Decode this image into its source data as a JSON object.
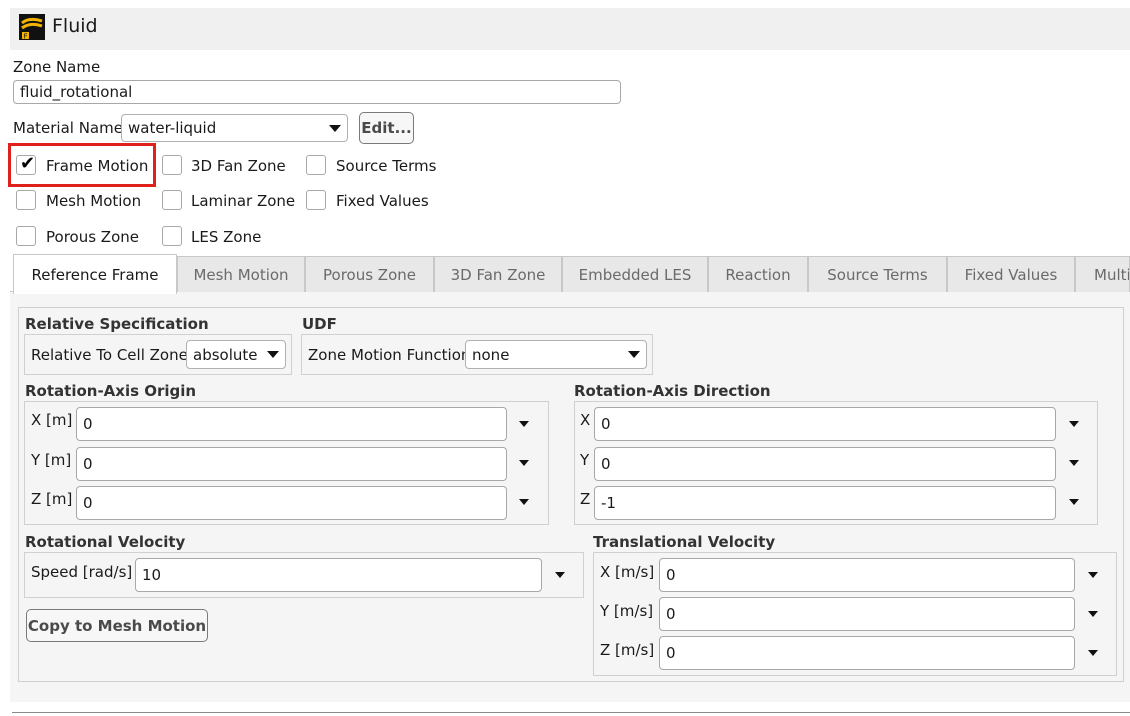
{
  "window": {
    "title": "Fluid"
  },
  "zone_name": {
    "label": "Zone Name",
    "value": "fluid_rotational"
  },
  "material": {
    "label": "Material Name",
    "value": "water-liquid",
    "edit_label": "Edit..."
  },
  "options": {
    "frame_motion": {
      "label": "Frame Motion",
      "checked": true
    },
    "fan_zone": {
      "label": "3D Fan Zone",
      "checked": false
    },
    "source_terms": {
      "label": "Source Terms",
      "checked": false
    },
    "mesh_motion": {
      "label": "Mesh Motion",
      "checked": false
    },
    "laminar_zone": {
      "label": "Laminar Zone",
      "checked": false
    },
    "fixed_values": {
      "label": "Fixed Values",
      "checked": false
    },
    "porous_zone": {
      "label": "Porous Zone",
      "checked": false
    },
    "les_zone": {
      "label": "LES Zone",
      "checked": false
    }
  },
  "tabs": [
    {
      "label": "Reference Frame",
      "active": true
    },
    {
      "label": "Mesh Motion"
    },
    {
      "label": "Porous Zone"
    },
    {
      "label": "3D Fan Zone"
    },
    {
      "label": "Embedded LES"
    },
    {
      "label": "Reaction"
    },
    {
      "label": "Source Terms"
    },
    {
      "label": "Fixed Values"
    },
    {
      "label": "Multi"
    }
  ],
  "relative_spec": {
    "title": "Relative Specification",
    "label": "Relative To Cell Zone",
    "value": "absolute"
  },
  "udf": {
    "title": "UDF",
    "label": "Zone Motion Function",
    "value": "none"
  },
  "axis_origin": {
    "title": "Rotation-Axis Origin",
    "x": {
      "label": "X [m]",
      "value": "0"
    },
    "y": {
      "label": "Y [m]",
      "value": "0"
    },
    "z": {
      "label": "Z [m]",
      "value": "0"
    }
  },
  "axis_direction": {
    "title": "Rotation-Axis Direction",
    "x": {
      "label": "X",
      "value": "0"
    },
    "y": {
      "label": "Y",
      "value": "0"
    },
    "z": {
      "label": "Z",
      "value": "-1"
    }
  },
  "rotational_velocity": {
    "title": "Rotational Velocity",
    "label": "Speed [rad/s]",
    "value": "10",
    "copy_label": "Copy to Mesh Motion"
  },
  "translational_velocity": {
    "title": "Translational Velocity",
    "x": {
      "label": "X [m/s]",
      "value": "0"
    },
    "y": {
      "label": "Y [m/s]",
      "value": "0"
    },
    "z": {
      "label": "Z [m/s]",
      "value": "0"
    }
  },
  "colors": {
    "highlight": "#e0201a",
    "panel": "#f5f5f5"
  }
}
